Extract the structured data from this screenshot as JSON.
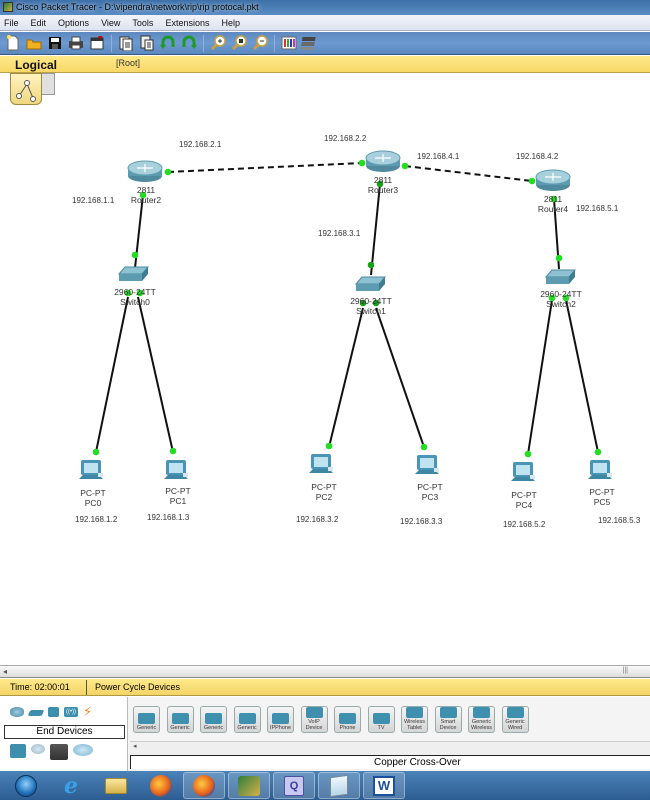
{
  "window": {
    "title": "Cisco Packet Tracer - D:\\vipendra\\network\\rip\\rip protocal.pkt"
  },
  "menu": [
    "File",
    "Edit",
    "Options",
    "View",
    "Tools",
    "Extensions",
    "Help"
  ],
  "toolbar": {
    "icons": [
      "new-icon",
      "open-icon",
      "save-icon",
      "print-icon",
      "activity-wizard-icon",
      "copy-icon",
      "paste-icon",
      "undo-icon",
      "redo-icon",
      "zoom-in-icon",
      "zoom-reset-icon",
      "zoom-out-icon",
      "palette-icon",
      "custom-device-icon"
    ]
  },
  "workspace": {
    "tab": "Logical",
    "breadcrumb": "[Root]"
  },
  "colors": {
    "link_up": "#22dd22",
    "link_line": "#111111",
    "yellow_bar": "#f7d867",
    "toolbar_blue": "#6c9bd0"
  },
  "devices": [
    {
      "id": "router2",
      "type": "router",
      "model": "2811",
      "name": "Router2"
    },
    {
      "id": "router3",
      "type": "router",
      "model": "2811",
      "name": "Router3"
    },
    {
      "id": "router4",
      "type": "router",
      "model": "2811",
      "name": "Router4"
    },
    {
      "id": "switch0",
      "type": "switch",
      "model": "2960-24TT",
      "name": "Switch0"
    },
    {
      "id": "switch1",
      "type": "switch",
      "model": "2960-24TT",
      "name": "Switch1"
    },
    {
      "id": "switch2",
      "type": "switch",
      "model": "2960-24TT",
      "name": "Switch2"
    },
    {
      "id": "pc0",
      "type": "pc",
      "model": "PC-PT",
      "name": "PC0",
      "ip": "192.168.1.2"
    },
    {
      "id": "pc1",
      "type": "pc",
      "model": "PC-PT",
      "name": "PC1",
      "ip": "192.168.1.3"
    },
    {
      "id": "pc2",
      "type": "pc",
      "model": "PC-PT",
      "name": "PC2",
      "ip": "192.168.3.2"
    },
    {
      "id": "pc3",
      "type": "pc",
      "model": "PC-PT",
      "name": "PC3",
      "ip": "192.168.3.3"
    },
    {
      "id": "pc4",
      "type": "pc",
      "model": "PC-PT",
      "name": "PC4",
      "ip": "192.168.5.2"
    },
    {
      "id": "pc5",
      "type": "pc",
      "model": "PC-PT",
      "name": "PC5",
      "ip": "192.168.5.3"
    }
  ],
  "ip_labels": {
    "r2_wan": "192.168.2.1",
    "r2_lan": "192.168.1.1",
    "r3_wan_left": "192.168.2.2",
    "r3_wan_right": "192.168.4.1",
    "r3_lan": "192.168.3.1",
    "r4_wan": "192.168.4.2",
    "r4_lan": "192.168.5.1"
  },
  "links": [
    {
      "from": "router2",
      "to": "router3",
      "style": "crossover"
    },
    {
      "from": "router3",
      "to": "router4",
      "style": "crossover"
    },
    {
      "from": "router2",
      "to": "switch0",
      "style": "straight"
    },
    {
      "from": "router3",
      "to": "switch1",
      "style": "straight"
    },
    {
      "from": "router4",
      "to": "switch2",
      "style": "straight"
    },
    {
      "from": "switch0",
      "to": "pc0",
      "style": "straight"
    },
    {
      "from": "switch0",
      "to": "pc1",
      "style": "straight"
    },
    {
      "from": "switch1",
      "to": "pc2",
      "style": "straight"
    },
    {
      "from": "switch1",
      "to": "pc3",
      "style": "straight"
    },
    {
      "from": "switch2",
      "to": "pc4",
      "style": "straight"
    },
    {
      "from": "switch2",
      "to": "pc5",
      "style": "straight"
    }
  ],
  "status": {
    "time": "Time: 02:00:01",
    "power_cycle": "Power Cycle Devices"
  },
  "device_panel": {
    "category_label": "End Devices",
    "categories_top": [
      "routers-icon",
      "switches-icon",
      "hubs-icon",
      "wireless-icon",
      "connections-icon"
    ],
    "categories_bottom": [
      "end-devices-icon",
      "wan-emulation-icon",
      "custom-devices-icon",
      "multiuser-icon"
    ],
    "devices": [
      {
        "label": "Generic",
        "icon": "pc-icon"
      },
      {
        "label": "Generic",
        "icon": "laptop-icon"
      },
      {
        "label": "Generic",
        "icon": "server-icon"
      },
      {
        "label": "Generic",
        "icon": "printer-icon"
      },
      {
        "label": "IPPhone",
        "icon": "ip-phone-icon"
      },
      {
        "label": "VoIP Device",
        "icon": "voip-icon"
      },
      {
        "label": "Phone",
        "icon": "phone-icon"
      },
      {
        "label": "TV",
        "icon": "tv-icon"
      },
      {
        "label": "Wireless Tablet",
        "icon": "tablet-icon"
      },
      {
        "label": "Smart Device",
        "icon": "smart-device-icon"
      },
      {
        "label": "Generic Wireless",
        "icon": "wireless-device-icon"
      },
      {
        "label": "Generic Wired",
        "icon": "wired-device-icon"
      }
    ],
    "selected_connection": "Copper Cross-Over"
  },
  "taskbar": {
    "items": [
      "start-button",
      "internet-explorer",
      "file-explorer",
      "firefox",
      "firefox",
      "packet-tracer",
      "dreamweaver",
      "notepad",
      "word"
    ]
  }
}
